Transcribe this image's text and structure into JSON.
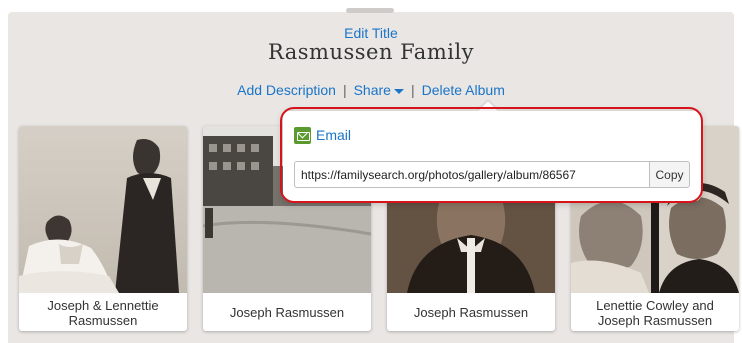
{
  "album": {
    "edit_title_label": "Edit Title",
    "title": "Rasmussen Family"
  },
  "actions": {
    "add_description": "Add Description",
    "separator": "|",
    "share": "Share",
    "delete_album": "Delete Album"
  },
  "share_popover": {
    "email_label": "Email",
    "url": "https://familysearch.org/photos/gallery/album/86567",
    "copy_label": "Copy"
  },
  "photos": [
    {
      "caption": "Joseph & Lennettie Rasmussen"
    },
    {
      "caption": "Joseph Rasmussen"
    },
    {
      "caption": "Joseph Rasmussen"
    },
    {
      "caption": "Lenettie Cowley and Joseph Rasmussen"
    }
  ],
  "colors": {
    "link": "#1a75c9",
    "highlight": "#d7141a",
    "email_icon": "#5a9a2f"
  }
}
